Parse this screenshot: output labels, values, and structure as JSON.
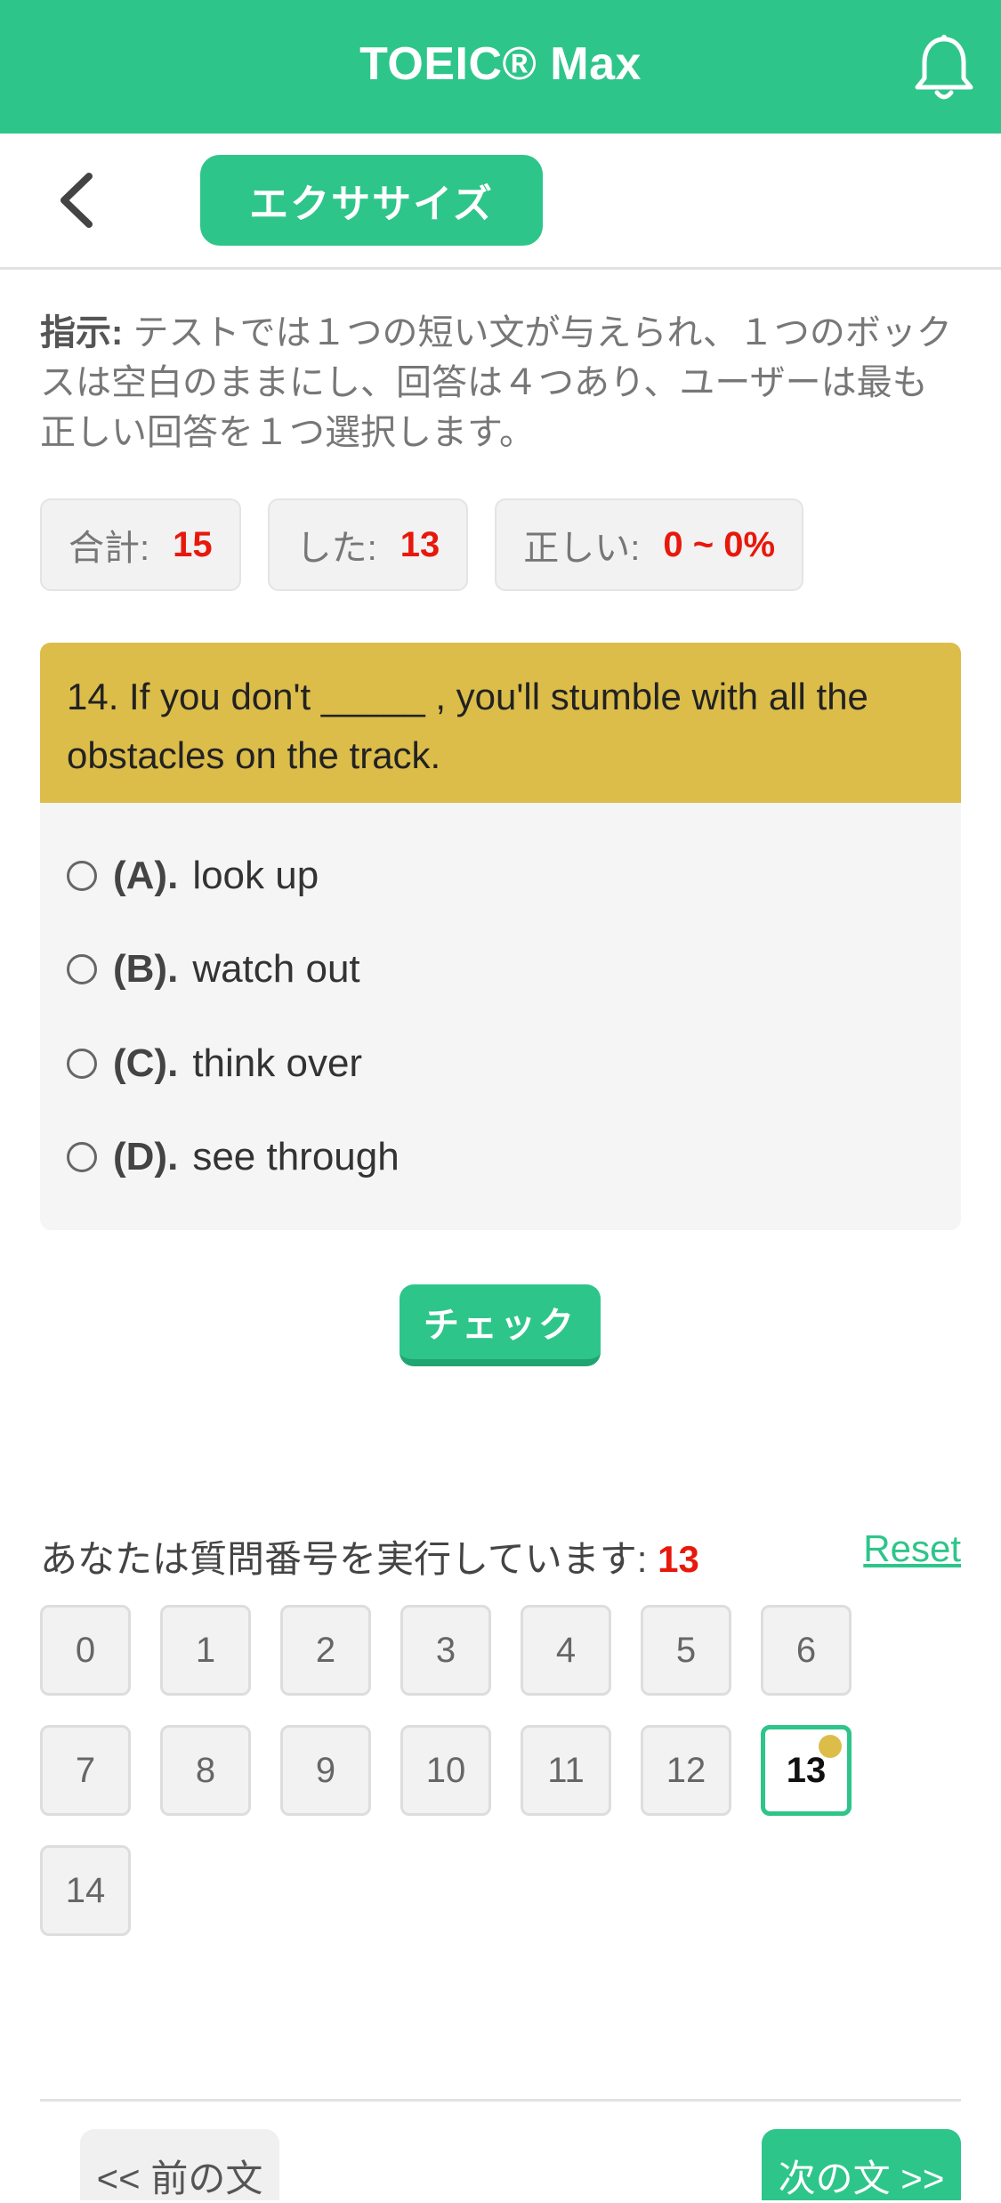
{
  "header": {
    "title": "TOEIC® Max"
  },
  "subbar": {
    "exercise_label": "エクササイズ"
  },
  "instructions": {
    "label": "指示:",
    "text": " テストでは１つの短い文が与えられ、１つのボックスは空白のままにし、回答は４つあり、ユーザーは最も正しい回答を１つ選択します。"
  },
  "stats": {
    "total_label": "合計:",
    "total_value": "15",
    "done_label": "した:",
    "done_value": "13",
    "correct_label": "正しい:",
    "correct_value": "0 ~ 0%"
  },
  "question": {
    "text": "14. If you don't _____ , you'll stumble with all the obstacles on the track.",
    "options": [
      {
        "letter": "(A).",
        "text": "look up"
      },
      {
        "letter": "(B).",
        "text": "watch out"
      },
      {
        "letter": "(C).",
        "text": "think over"
      },
      {
        "letter": "(D).",
        "text": "see through"
      }
    ]
  },
  "check_label": "チェック",
  "progress": {
    "label": "あなたは質問番号を実行しています:",
    "current": "13",
    "reset_label": "Reset"
  },
  "question_numbers": [
    "0",
    "1",
    "2",
    "3",
    "4",
    "5",
    "6",
    "7",
    "8",
    "9",
    "10",
    "11",
    "12",
    "13",
    "14"
  ],
  "footer": {
    "prev_label": "<< 前の文",
    "next_label": "次の文 >>"
  },
  "colors": {
    "primary": "#2ec58a",
    "question_header": "#dcbd4a",
    "highlight": "#e8180c"
  }
}
